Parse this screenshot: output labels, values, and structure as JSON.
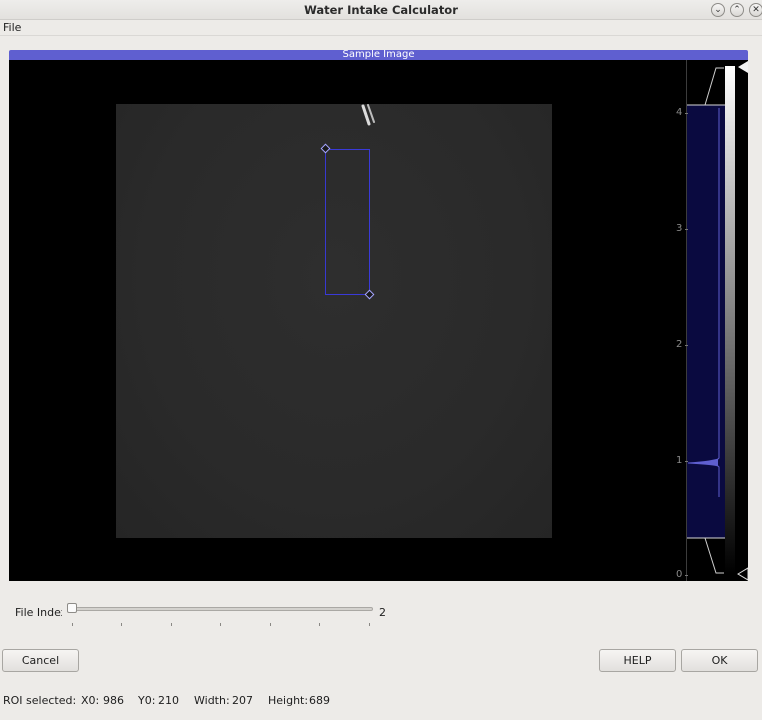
{
  "window": {
    "title": "Water Intake Calculator",
    "controls": [
      "⌄",
      "⌃",
      "✕"
    ]
  },
  "menu": {
    "file": "File"
  },
  "panel": {
    "title": "Sample Image"
  },
  "histogram": {
    "ticks": [
      "4",
      "3",
      "2",
      "1",
      "0"
    ],
    "accent": "#5f5fd0",
    "fill": "#0a0a40"
  },
  "slider": {
    "label": "File Index",
    "value": "2",
    "fraction": 0.0
  },
  "buttons": {
    "cancel": "Cancel",
    "help": "HELP",
    "ok": "OK"
  },
  "status": {
    "roi_label": "ROI selected:",
    "x0_label": "X0:",
    "x0_value": "986",
    "y0_label": "Y0:",
    "y0_value": "210",
    "width_label": "Width:",
    "width_value": "207",
    "height_label": "Height:",
    "height_value": "689"
  }
}
